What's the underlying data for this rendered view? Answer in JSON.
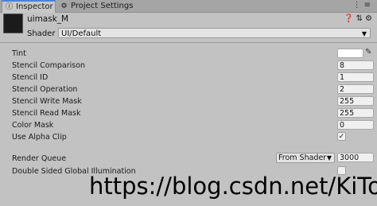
{
  "tabs": [
    {
      "label": "Inspector",
      "icon": "info-icon"
    },
    {
      "label": "Project Settings",
      "icon": "gear-icon"
    }
  ],
  "tab_controls": [
    "more-options-icon",
    "lock-icon"
  ],
  "material": {
    "name": "uimask_M",
    "header_icons": [
      "help-icon",
      "settings-sliders-icon",
      "gear-icon"
    ],
    "shader_label": "Shader",
    "shader_value": "UI/Default"
  },
  "properties": {
    "tint": {
      "label": "Tint",
      "color": "#ffffff"
    },
    "stencil_comparison": {
      "label": "Stencil Comparison",
      "value": "8"
    },
    "stencil_id": {
      "label": "Stencil ID",
      "value": "1"
    },
    "stencil_operation": {
      "label": "Stencil Operation",
      "value": "2"
    },
    "stencil_write_mask": {
      "label": "Stencil Write Mask",
      "value": "255"
    },
    "stencil_read_mask": {
      "label": "Stencil Read Mask",
      "value": "255"
    },
    "color_mask": {
      "label": "Color Mask",
      "value": "0"
    },
    "use_alpha_clip": {
      "label": "Use Alpha Clip",
      "checked": true,
      "check_glyph": "✓"
    },
    "render_queue": {
      "label": "Render Queue",
      "mode": "From Shader",
      "value": "3000"
    },
    "double_sided_gi": {
      "label": "Double Sided Global Illumination",
      "checked": false
    }
  },
  "watermark": "https://blog.csdn.net/KiTok",
  "colors": {
    "panel": "#c2c2c2",
    "tabbar": "#a5a5a5",
    "active_tab_accent": "#4a83d8"
  }
}
